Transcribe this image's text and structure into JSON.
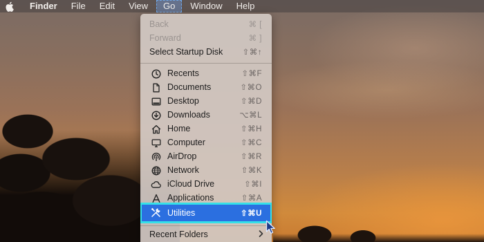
{
  "menubar": {
    "items": [
      {
        "label": "Finder"
      },
      {
        "label": "File"
      },
      {
        "label": "Edit"
      },
      {
        "label": "View"
      },
      {
        "label": "Go"
      },
      {
        "label": "Window"
      },
      {
        "label": "Help"
      }
    ],
    "active_item": "Go"
  },
  "go_menu": {
    "items": [
      {
        "label": "Back",
        "shortcut": "⌘ [",
        "enabled": false
      },
      {
        "label": "Forward",
        "shortcut": "⌘ ]",
        "enabled": false
      },
      {
        "label": "Select Startup Disk",
        "shortcut": "⇧⌘↑",
        "enabled": true
      },
      {
        "label": "Recents",
        "shortcut": "⇧⌘F",
        "icon": "clock-icon"
      },
      {
        "label": "Documents",
        "shortcut": "⇧⌘O",
        "icon": "document-icon"
      },
      {
        "label": "Desktop",
        "shortcut": "⇧⌘D",
        "icon": "desktop-icon"
      },
      {
        "label": "Downloads",
        "shortcut": "⌥⌘L",
        "icon": "download-icon"
      },
      {
        "label": "Home",
        "shortcut": "⇧⌘H",
        "icon": "home-icon"
      },
      {
        "label": "Computer",
        "shortcut": "⇧⌘C",
        "icon": "computer-icon"
      },
      {
        "label": "AirDrop",
        "shortcut": "⇧⌘R",
        "icon": "airdrop-icon"
      },
      {
        "label": "Network",
        "shortcut": "⇧⌘K",
        "icon": "globe-icon"
      },
      {
        "label": "iCloud Drive",
        "shortcut": "⇧⌘I",
        "icon": "cloud-icon"
      },
      {
        "label": "Applications",
        "shortcut": "⇧⌘A",
        "icon": "applications-icon"
      },
      {
        "label": "Utilities",
        "shortcut": "⇧⌘U",
        "icon": "tools-icon",
        "highlighted": true
      },
      {
        "label": "Recent Folders",
        "submenu": true
      }
    ]
  },
  "colors": {
    "highlight": "#2b6fe0",
    "annotation_outline": "#35e0e8"
  }
}
